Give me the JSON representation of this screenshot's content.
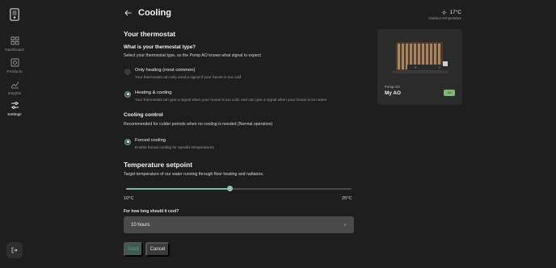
{
  "sidebar": {
    "items": [
      {
        "label": "Dashboard",
        "icon": "grid-icon"
      },
      {
        "label": "Products",
        "icon": "product-icon"
      },
      {
        "label": "Insights",
        "icon": "chart-icon"
      },
      {
        "label": "Settings",
        "icon": "sliders-icon"
      }
    ],
    "active": "Settings"
  },
  "header": {
    "title": "Cooling"
  },
  "weather": {
    "temperature": "17°C",
    "label": "Outdoor temperature"
  },
  "thermostat": {
    "title": "Your thermostat",
    "question": "What is your thermostat type?",
    "subtitle": "Select your thermostat type, so the Pomp AO knows what signal to expect",
    "options": [
      {
        "label": "Only heating (most common)",
        "description": "Your thermostat can only send a signal if your house is too cold",
        "selected": false
      },
      {
        "label": "Heating & cooling",
        "description": "Your thermostat can give a signal when your house is too cold, and can give a signal when your house is too warm",
        "selected": true
      }
    ]
  },
  "cooling_control": {
    "title": "Cooling control",
    "subtitle": "Recommended for colder periods when no cooling is needed (Normal operation)",
    "option": {
      "label": "Forced cooling",
      "description": "Enable forced cooling for specific temperatures",
      "selected": true
    }
  },
  "setpoint": {
    "title": "Temperature setpoint",
    "subtitle": "Target temperature of our water running through floor heating and radiators.",
    "min_label": "10°C",
    "max_label": "25°C",
    "min": 10,
    "max": 25,
    "value_fraction": 0.46
  },
  "duration": {
    "label": "For how long should it cool?",
    "value": "10 hours"
  },
  "buttons": {
    "save": "Save",
    "cancel": "Cancel"
  },
  "device": {
    "subtitle": "Pomp AO",
    "name": "My AO",
    "status": "On"
  },
  "colors": {
    "accent": "#7fb8a4",
    "status_on": "#7cba72",
    "background": "#1e1e1e",
    "card": "#2b2b2b"
  }
}
